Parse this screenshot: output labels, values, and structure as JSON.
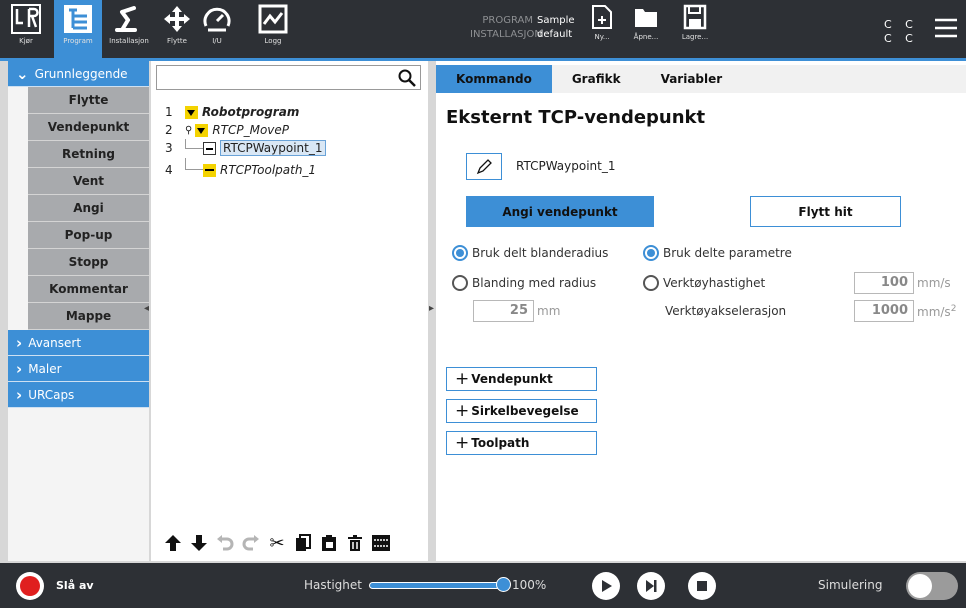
{
  "topbar": {
    "buttons": [
      {
        "label": "Kjør"
      },
      {
        "label": "Program"
      },
      {
        "label": "Installasjon"
      },
      {
        "label": "Flytte"
      },
      {
        "label": "I/U"
      },
      {
        "label": "Logg"
      }
    ],
    "program_key": "PROGRAM",
    "program_value": "Sample",
    "installation_key": "INSTALLASJON",
    "installation_value": "default",
    "file_buttons": [
      {
        "label": "Ny..."
      },
      {
        "label": "Åpne..."
      },
      {
        "label": "Lagre..."
      }
    ],
    "cc_line1": "C C",
    "cc_line2": "C C",
    "active_color": "#3d8fd6"
  },
  "leftnav": {
    "basic_label": "Grunnleggende",
    "items": [
      "Flytte",
      "Vendepunkt",
      "Retning",
      "Vent",
      "Angi",
      "Pop-up",
      "Stopp",
      "Kommentar",
      "Mappe"
    ],
    "categories": [
      "Avansert",
      "Maler",
      "URCaps"
    ]
  },
  "tree": {
    "search_placeholder": "",
    "rows": [
      {
        "num": "1",
        "label": "Robotprogram"
      },
      {
        "num": "2",
        "label": "RTCP_MoveP"
      },
      {
        "num": "3",
        "label": "RTCPWaypoint_1"
      },
      {
        "num": "4",
        "label": "RTCPToolpath_1"
      }
    ]
  },
  "panel": {
    "tabs": [
      "Kommando",
      "Grafikk",
      "Variabler"
    ],
    "heading": "Eksternt TCP-vendepunkt",
    "waypoint_name": "RTCPWaypoint_1",
    "set_waypoint": "Angi vendepunkt",
    "move_here": "Flytt hit",
    "radio_shared_blend": "Bruk delt blanderadius",
    "radio_blend_radius": "Blanding med radius",
    "blend_value": "25",
    "blend_unit": "mm",
    "radio_shared_params": "Bruk delte parametre",
    "radio_tool_speed": "Verktøyhastighet",
    "tool_speed_value": "100",
    "tool_speed_unit": "mm/s",
    "tool_accel_label": "Verktøyakselerasjon",
    "tool_accel_value": "1000",
    "tool_accel_unit": "mm/s",
    "tool_accel_exp": "2",
    "add_waypoint": "Vendepunkt",
    "add_circle": "Sirkelbevegelse",
    "add_toolpath": "Toolpath"
  },
  "bottom": {
    "power_label": "Slå av",
    "speed_label": "Hastighet",
    "speed_value": "100%",
    "speed_fraction": 1.0,
    "sim_label": "Simulering"
  }
}
